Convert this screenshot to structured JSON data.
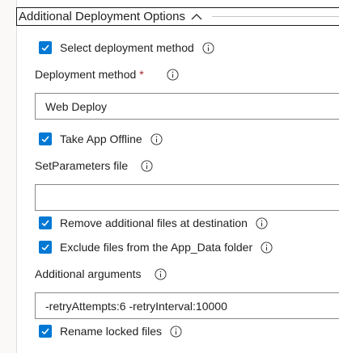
{
  "section": {
    "title": "Additional Deployment Options"
  },
  "select_deployment_method": {
    "label": "Select deployment method",
    "checked": true
  },
  "deployment_method": {
    "label": "Deployment method",
    "required_marker": "*",
    "value": "Web Deploy"
  },
  "take_app_offline": {
    "label": "Take App Offline",
    "checked": true
  },
  "set_parameters_file": {
    "label": "SetParameters file",
    "value": ""
  },
  "remove_additional_files": {
    "label": "Remove additional files at destination",
    "checked": true
  },
  "exclude_app_data": {
    "label": "Exclude files from the App_Data folder",
    "checked": true
  },
  "additional_arguments": {
    "label": "Additional arguments",
    "value": "-retryAttempts:6 -retryInterval:10000"
  },
  "rename_locked_files": {
    "label": "Rename locked files",
    "checked": true
  },
  "colors": {
    "checkbox_accent": "#0078d4",
    "required": "#a4262c",
    "input_border": "#8a8886"
  },
  "icons": {
    "info": "info-circle-icon",
    "check": "checkmark-icon",
    "collapse": "chevron-up-icon"
  }
}
